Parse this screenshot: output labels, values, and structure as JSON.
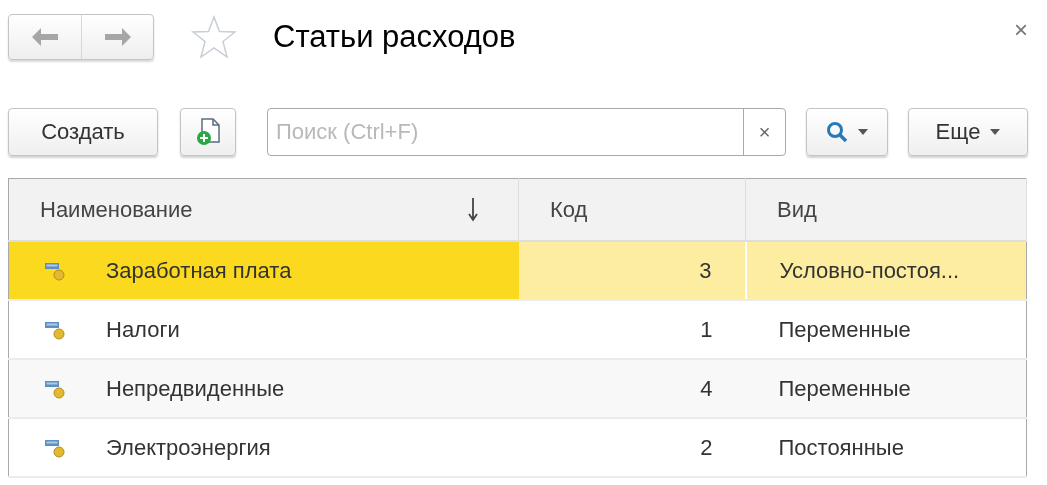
{
  "window": {
    "title": "Статьи расходов",
    "favorite": false
  },
  "toolbar": {
    "create_button": "Создать",
    "search": {
      "placeholder": "Поиск (Ctrl+F)",
      "clear": "×"
    },
    "more_button": "Еще"
  },
  "table": {
    "columns": [
      {
        "label": "Наименование",
        "sorted": true
      },
      {
        "label": "Код",
        "sorted": false
      },
      {
        "label": "Вид",
        "sorted": false
      }
    ],
    "rows": [
      {
        "name": "Заработная плата",
        "code": "3",
        "kind": "Условно-постоя...",
        "selected": true
      },
      {
        "name": "Налоги",
        "code": "1",
        "kind": "Переменные",
        "selected": false
      },
      {
        "name": "Непредвиденные",
        "code": "4",
        "kind": "Переменные",
        "selected": false
      },
      {
        "name": "Электроэнергия",
        "code": "2",
        "kind": "Постоянные",
        "selected": false
      }
    ]
  },
  "close": "×"
}
